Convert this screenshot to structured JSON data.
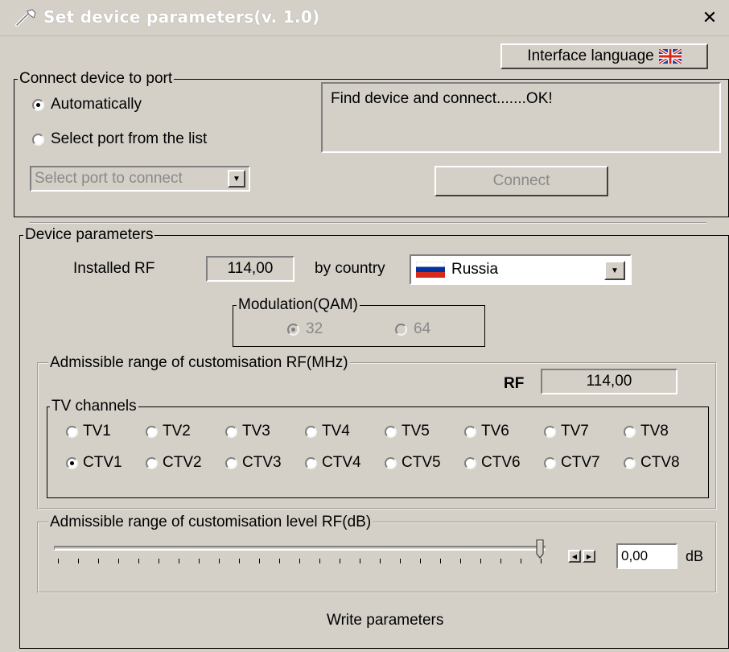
{
  "window": {
    "title": "Set device parameters(v. 1.0)",
    "close_glyph": "✕",
    "icon": "wrench-icon"
  },
  "interface_language": {
    "label": "Interface language",
    "flag_icon": "uk-flag-icon"
  },
  "connect_group": {
    "legend": "Connect device to port",
    "radio_auto": "Automatically",
    "radio_list": "Select port from the list",
    "selected": "Automatically",
    "port_select_placeholder": "Select port to connect",
    "status_text": "Find device and connect.......OK!",
    "connect_button": "Connect"
  },
  "device_params": {
    "legend": "Device parameters",
    "installed_rf_label": "Installed RF",
    "installed_rf_value": "114,00",
    "by_country_label": "by country",
    "country_value": "Russia",
    "country_flag_icon": "russia-flag-icon",
    "modulation": {
      "legend": "Modulation(QAM)",
      "options": [
        "32",
        "64"
      ],
      "selected": "32"
    },
    "range_rf": {
      "legend": "Admissible range of customisation RF(MHz)",
      "rf_label": "RF",
      "rf_value": "114,00",
      "tv_channels": {
        "legend": "TV channels",
        "row1": [
          "TV1",
          "TV2",
          "TV3",
          "TV4",
          "TV5",
          "TV6",
          "TV7",
          "TV8"
        ],
        "row2": [
          "CTV1",
          "CTV2",
          "CTV3",
          "CTV4",
          "CTV5",
          "CTV6",
          "CTV7",
          "CTV8"
        ],
        "selected": "CTV1"
      }
    },
    "range_level": {
      "legend": "Admissible range of customisation level RF(dB)",
      "slider_position_fraction": 1.0,
      "value": "0,00",
      "unit": "dB"
    },
    "write_button": "Write parameters"
  },
  "colors": {
    "face": "#d4d0c8",
    "flag_russia": [
      "#ffffff",
      "#0033a0",
      "#d52b1e"
    ]
  }
}
